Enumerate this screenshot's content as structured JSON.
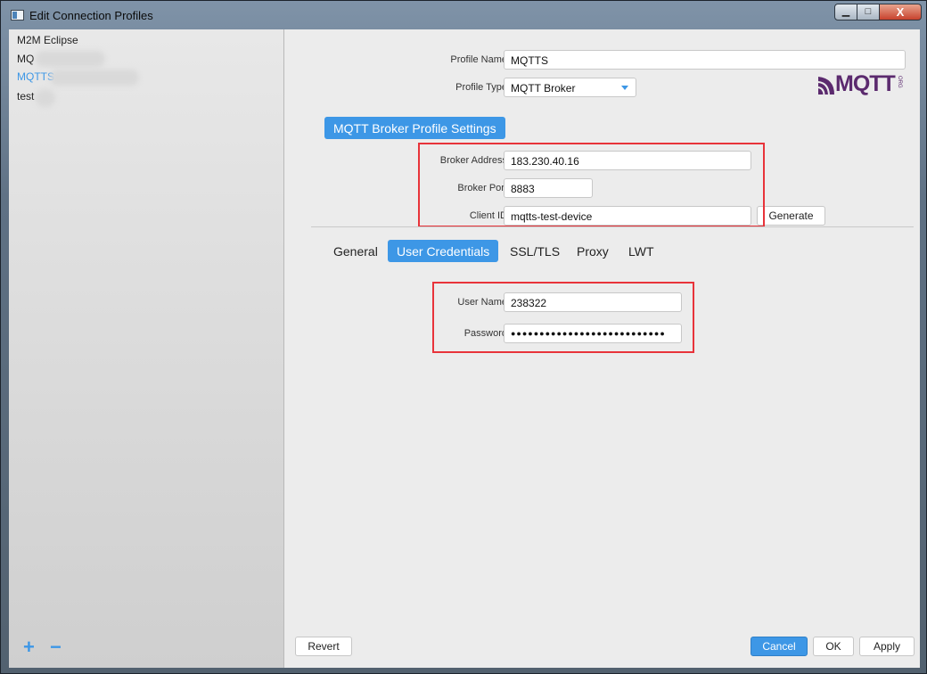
{
  "window": {
    "title": "Edit Connection Profiles",
    "controls": {
      "minimize": "▁",
      "maximize": "□",
      "close": "X"
    }
  },
  "sidebar": {
    "profiles": [
      {
        "label": "M2M Eclipse",
        "selected": false
      },
      {
        "label": "MQ",
        "selected": false
      },
      {
        "label": "MQTTS",
        "selected": true
      },
      {
        "label": "test",
        "selected": false
      }
    ],
    "add_label": "+",
    "remove_label": "−"
  },
  "profile": {
    "name_label": "Profile Name",
    "name_value": "MQTTS",
    "type_label": "Profile Type",
    "type_value": "MQTT Broker",
    "logo_text": "MQTT",
    "logo_tag": "ORG"
  },
  "broker": {
    "section_title": "MQTT Broker Profile Settings",
    "address_label": "Broker Address",
    "address_value": "183.230.40.16",
    "port_label": "Broker Port",
    "port_value": "8883",
    "client_id_label": "Client ID",
    "client_id_value": "mqtts-test-device",
    "generate_label": "Generate"
  },
  "tabs": [
    {
      "label": "General",
      "active": false
    },
    {
      "label": "User Credentials",
      "active": true
    },
    {
      "label": "SSL/TLS",
      "active": false
    },
    {
      "label": "Proxy",
      "active": false
    },
    {
      "label": "LWT",
      "active": false
    }
  ],
  "credentials": {
    "username_label": "User Name",
    "username_value": "238322",
    "password_label": "Password",
    "password_masked": "●●●●●●●●●●●●●●●●●●●●●●●●●●●"
  },
  "footer": {
    "revert_label": "Revert",
    "cancel_label": "Cancel",
    "ok_label": "OK",
    "apply_label": "Apply"
  },
  "colors": {
    "accent": "#3d97e6",
    "highlight_box": "#e8333a",
    "logo": "#5b2a6e"
  }
}
